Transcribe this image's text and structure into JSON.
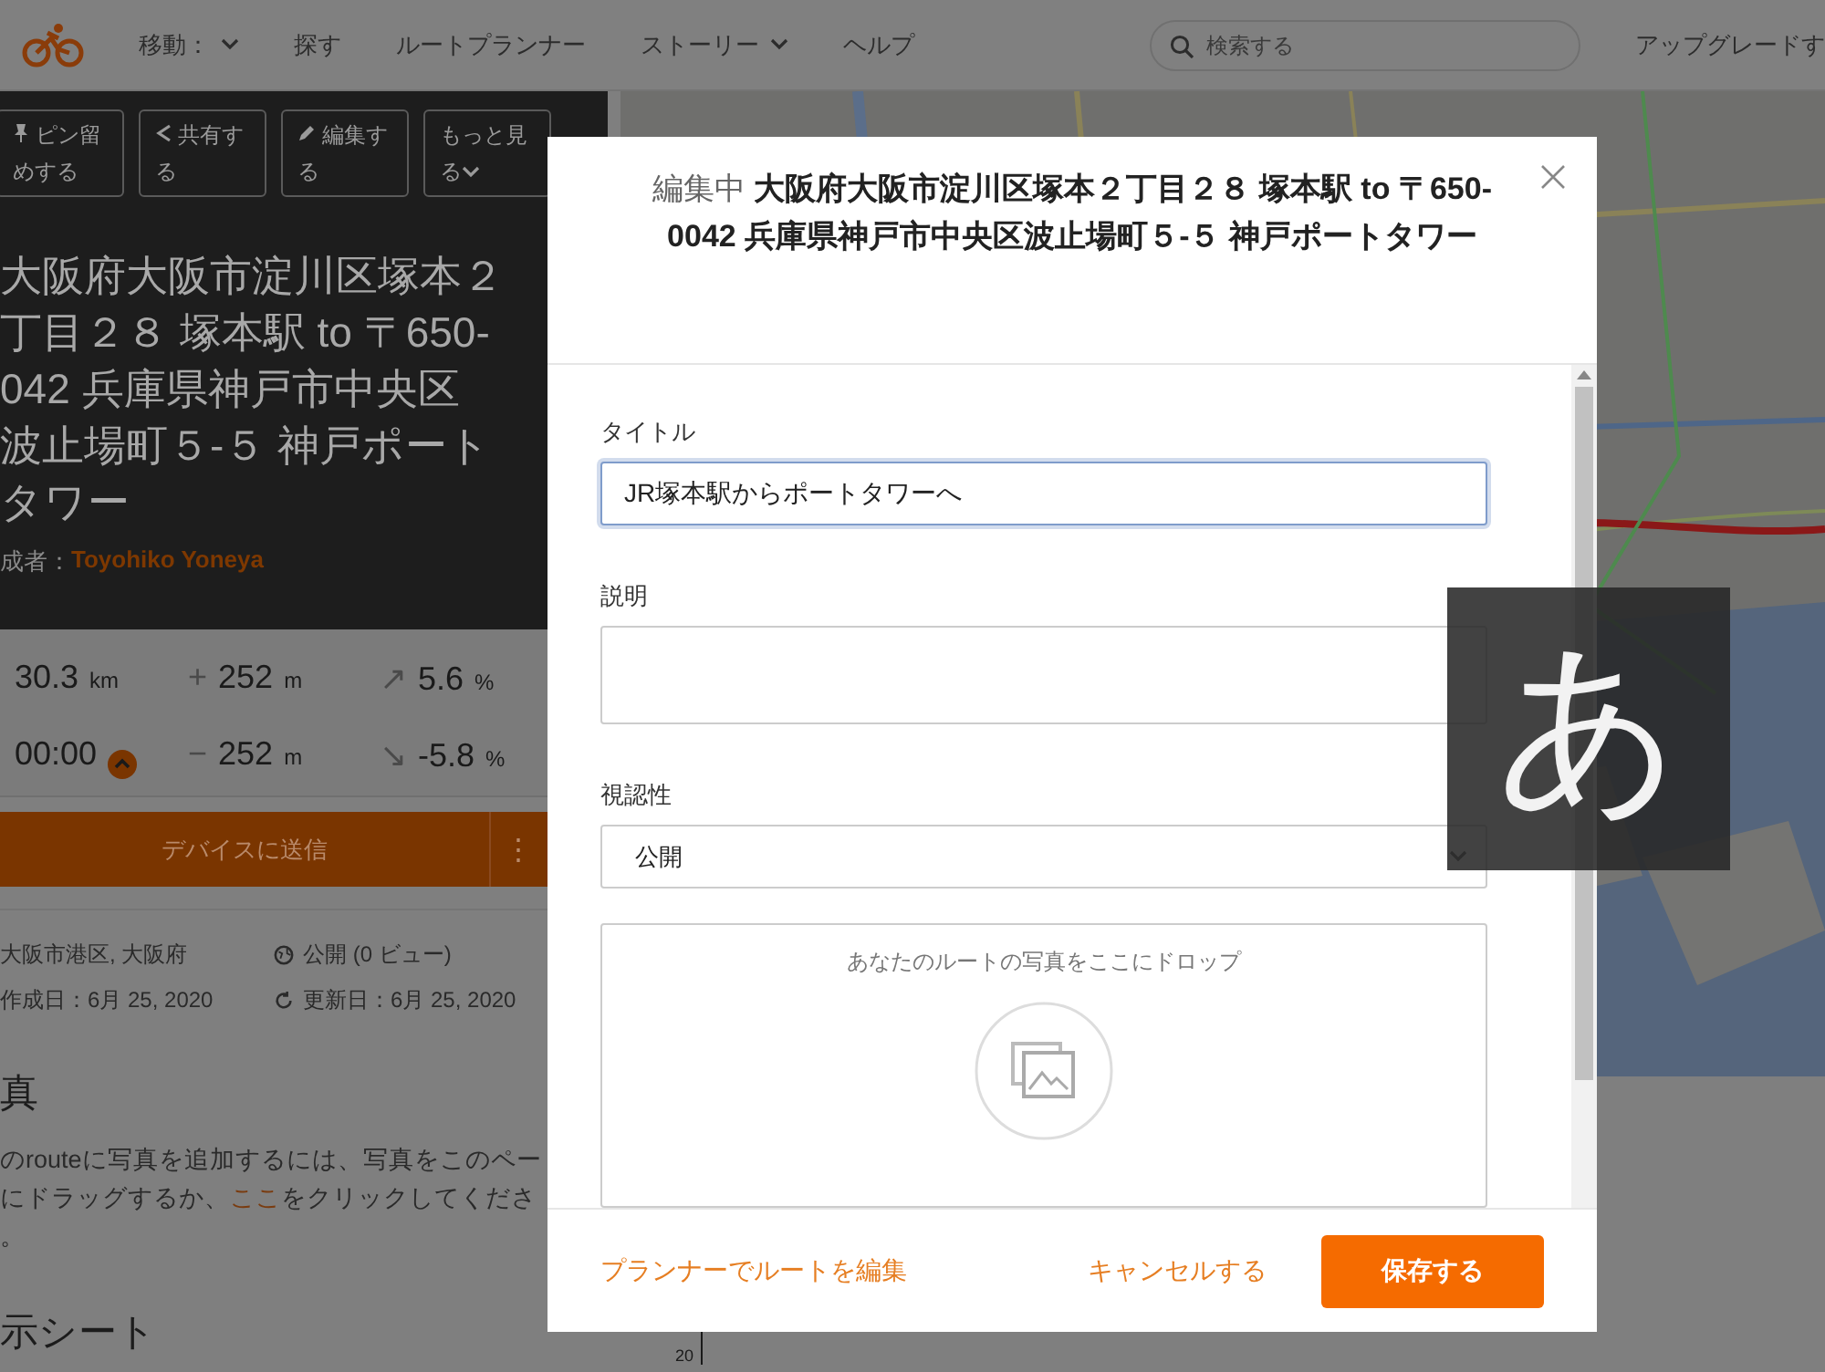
{
  "nav": {
    "items": [
      {
        "label": "移動：",
        "dropdown": true
      },
      {
        "label": "探す",
        "dropdown": false
      },
      {
        "label": "ルートプランナー",
        "dropdown": false
      },
      {
        "label": "ストーリー",
        "dropdown": true
      },
      {
        "label": "ヘルプ",
        "dropdown": false
      }
    ],
    "search": {
      "placeholder": "検索する"
    },
    "upgrade": "アップグレードす"
  },
  "route_panel": {
    "actions": [
      {
        "label": "ピン留めする",
        "caret": false
      },
      {
        "label": "共有する",
        "caret": false
      },
      {
        "label": "編集する",
        "caret": false
      },
      {
        "label": "もっと見る",
        "caret": true
      }
    ],
    "title_lines": [
      "大阪府大阪市淀川区塚本２",
      "丁目２８ 塚本駅 to 〒650-",
      "042 兵庫県神戸市中央区",
      "波止場町５-５ 神戸ポート",
      "タワー"
    ],
    "author_label": "成者：",
    "author": "Toyohiko Yoneya",
    "stats": [
      {
        "value": "30.3",
        "unit": "km",
        "badge": false
      },
      {
        "icon": "+",
        "value": "252",
        "unit": "m",
        "badge": false
      },
      {
        "icon": "↗",
        "value": "5.6",
        "unit": "%",
        "badge": false
      },
      {
        "value": "00:00",
        "badge": true
      },
      {
        "icon": "−",
        "value": "252",
        "unit": "m",
        "badge": false
      },
      {
        "icon": "↘",
        "value": "-5.8",
        "unit": "%",
        "badge": false
      }
    ],
    "send_button": "デバイスに送信",
    "more_button": "⋮",
    "meta": [
      "大阪市港区, 大阪府",
      "公開 (0 ビュー)",
      "作成日：6月 25, 2020",
      "更新日：6月 25, 2020"
    ],
    "photos_heading": "真",
    "photos_text": [
      [
        {
          "kind": "text",
          "text": "のrouteに写真を追加するには、写真をこのペー"
        }
      ],
      [
        {
          "kind": "text",
          "text": "にドラッグするか、"
        },
        {
          "kind": "link",
          "text": "ここ"
        },
        {
          "kind": "text",
          "text": "をクリックしてくださ"
        }
      ],
      [
        {
          "kind": "text",
          "text": "。"
        }
      ]
    ],
    "cue_heading": "示シート"
  },
  "elevation": {
    "tick": "20"
  },
  "modal": {
    "title_prefix": "編集中",
    "title": "大阪府大阪市淀川区塚本２丁目２８ 塚本駅 to 〒650-0042 兵庫県神戸市中央区波止場町５-５ 神戸ポートタワー",
    "fields": [
      {
        "kind": "input",
        "label": "タイトル",
        "value": "JR塚本駅からポートタワーへ",
        "focused": true
      },
      {
        "kind": "textarea",
        "label": "説明",
        "focused": false
      },
      {
        "kind": "select",
        "label": "視認性",
        "value": "公開",
        "focused": false
      },
      {
        "kind": "dropzone",
        "label": "あなたのルートの写真をここにドロップ"
      }
    ],
    "planner_link": "プランナーでルートを編集",
    "cancel": "キャンセルする",
    "save": "保存する"
  },
  "ime": {
    "label": "あ"
  }
}
